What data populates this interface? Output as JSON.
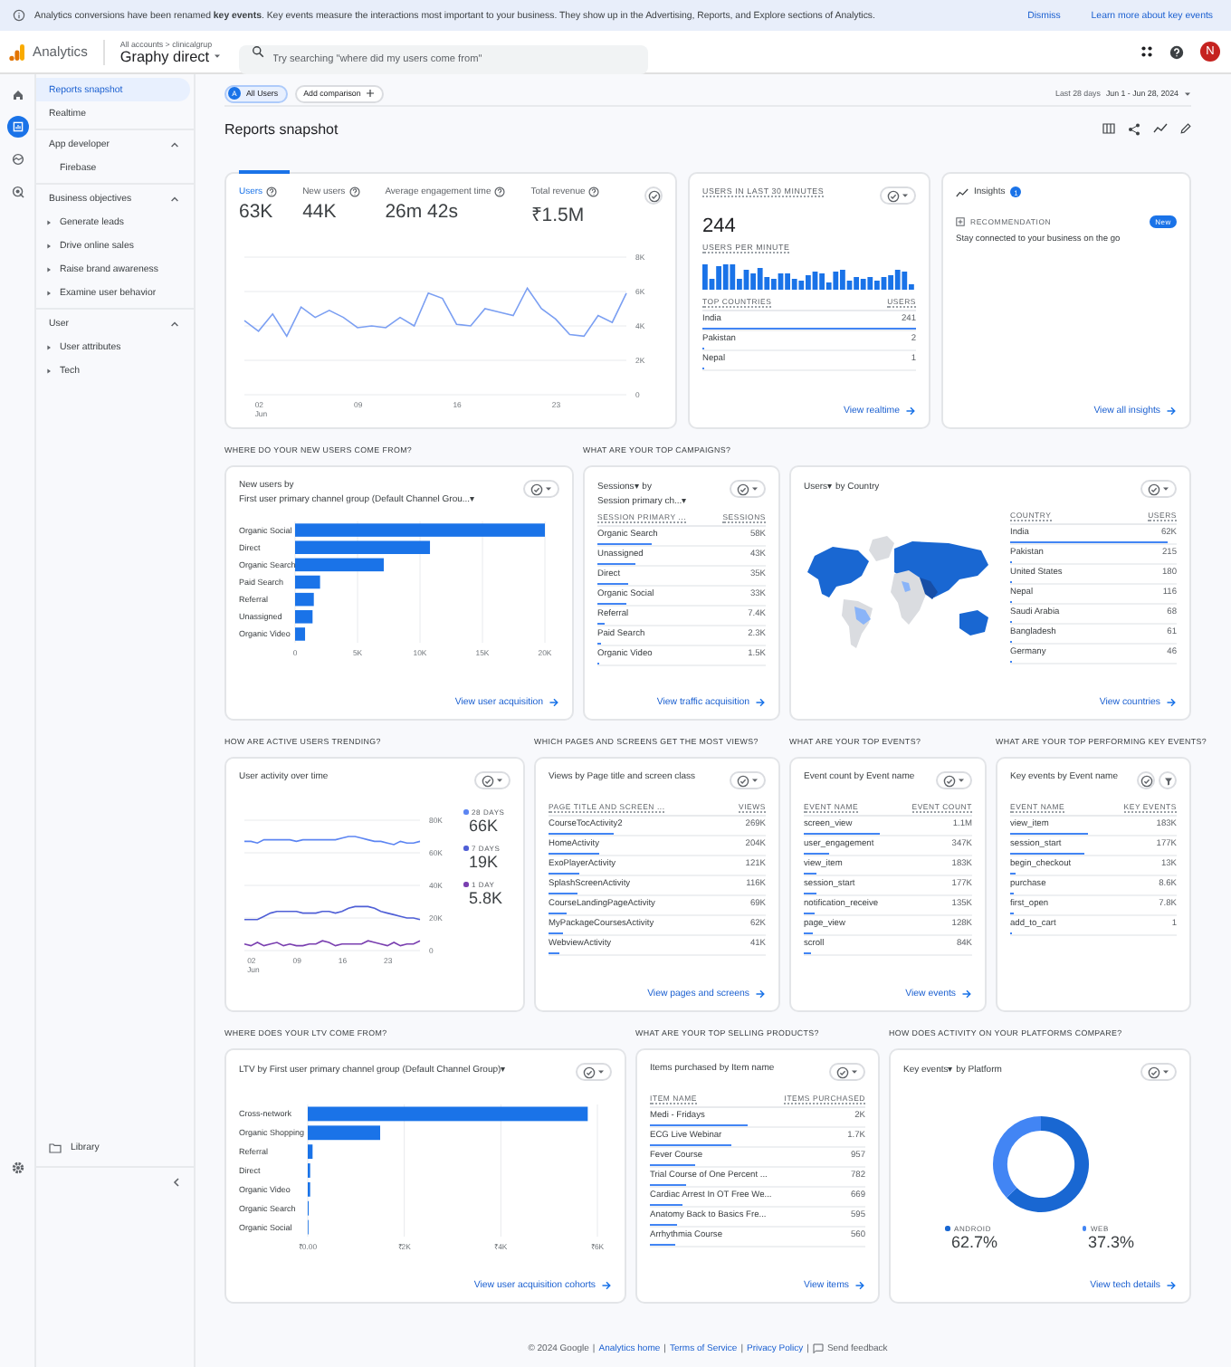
{
  "banner": {
    "text": "Analytics conversions have been renamed **key events**. Key events measure the interactions most important to your business. They show up in the Advertising, Reports, and Explore sections of Analytics.",
    "actions": [
      "Dismiss",
      "Learn more about key events"
    ]
  },
  "header": {
    "product": "Analytics",
    "breadcrumb": "All accounts > clinicalgrup",
    "property": "Graphy direct",
    "search": {
      "placeholder": "Try searching \"where did my users come from\""
    },
    "avatar": "N"
  },
  "rail": [
    {
      "kind": "home",
      "selected": false
    },
    {
      "kind": "reports",
      "selected": true
    },
    {
      "kind": "explore",
      "selected": false
    },
    {
      "kind": "advertising",
      "selected": false
    }
  ],
  "sidebar": {
    "items": [
      {
        "label": "Reports snapshot",
        "selected": true
      },
      {
        "label": "Realtime",
        "selected": false
      }
    ],
    "sections": [
      {
        "label": "App developer",
        "expanded": true,
        "children": [
          {
            "label": "Firebase",
            "expandable": false
          }
        ]
      },
      {
        "label": "Business objectives",
        "expanded": true,
        "children": [
          {
            "label": "Generate leads",
            "expandable": true
          },
          {
            "label": "Drive online sales",
            "expandable": true
          },
          {
            "label": "Raise brand awareness",
            "expandable": true
          },
          {
            "label": "Examine user behavior",
            "expandable": true
          }
        ]
      },
      {
        "label": "User",
        "expanded": true,
        "children": [
          {
            "label": "User attributes",
            "expandable": true
          },
          {
            "label": "Tech",
            "expandable": true
          }
        ]
      }
    ],
    "library": "Library"
  },
  "toolbar": {
    "segment_badge": "A",
    "segment": "All Users",
    "add_comparison": "Add comparison",
    "date_label": "Last 28 days",
    "date_range": "Jun 1 - Jun 28, 2024"
  },
  "page_title": "Reports snapshot",
  "overview": {
    "metrics": [
      {
        "label": "Users",
        "value": "63K",
        "selected": true
      },
      {
        "label": "New users",
        "value": "44K",
        "selected": false
      },
      {
        "label": "Average engagement time",
        "value": "26m 42s",
        "selected": false
      },
      {
        "label": "Total revenue",
        "value": "₹1.5M",
        "selected": false
      }
    ],
    "chart_data": {
      "type": "line",
      "x": [
        1,
        2,
        3,
        4,
        5,
        6,
        7,
        8,
        9,
        10,
        11,
        12,
        13,
        14,
        15,
        16,
        17,
        18,
        19,
        20,
        21,
        22,
        23,
        24,
        25,
        26,
        27,
        28
      ],
      "xlim": [
        1,
        28
      ],
      "ylim": [
        0,
        8000
      ],
      "grid": true,
      "series": [
        {
          "color": "#7b9ff2",
          "values": [
            4300,
            3700,
            4700,
            3400,
            5100,
            4500,
            4900,
            4500,
            3900,
            4000,
            3900,
            4500,
            4000,
            5900,
            5600,
            4100,
            4000,
            5000,
            4800,
            4600,
            6200,
            5000,
            4400,
            3500,
            3400,
            4600,
            4200,
            5900
          ]
        }
      ],
      "xticks": [
        {
          "value": 2,
          "label": "02 Jun"
        },
        {
          "value": 9,
          "label": "09"
        },
        {
          "value": 16,
          "label": "16"
        },
        {
          "value": 23,
          "label": "23"
        }
      ],
      "yticks": [
        {
          "value": 0,
          "label": "0"
        },
        {
          "value": 2000,
          "label": "2K"
        },
        {
          "value": 4000,
          "label": "4K"
        },
        {
          "value": 6000,
          "label": "6K"
        },
        {
          "value": 8000,
          "label": "8K"
        }
      ]
    }
  },
  "realtime": {
    "heading": "USERS IN LAST 30 MINUTES",
    "value": "244",
    "subheading": "USERS PER MINUTE",
    "columns": [
      "TOP COUNTRIES",
      "USERS"
    ],
    "rows": [
      {
        "name": "India",
        "value": "241",
        "level": 1
      },
      {
        "name": "Pakistan",
        "value": "2",
        "level": 0.01
      },
      {
        "name": "Nepal",
        "value": "1",
        "level": 0.01
      }
    ],
    "link": "View realtime"
  },
  "insights": {
    "title": "Insights",
    "count": "1",
    "tag": "RECOMMENDATION",
    "badge": "New",
    "text": "Stay connected to your business on the go",
    "link": "View all insights"
  },
  "acquisition": {
    "heading": "WHERE DO YOUR NEW USERS COME FROM?",
    "title_lines": [
      "New users by",
      "First user primary channel group (Default Channel Grou...▾"
    ],
    "chart_data": {
      "type": "bar",
      "orientation": "horizontal",
      "xlim": [
        0,
        20000
      ],
      "grid": true,
      "categories": [
        "Organic Social",
        "Direct",
        "Organic Search",
        "Paid Search",
        "Referral",
        "Unassigned",
        "Organic Video"
      ],
      "values": [
        20000,
        10800,
        7100,
        2000,
        1500,
        1400,
        800
      ],
      "xticks": [
        {
          "value": 0,
          "label": "0"
        },
        {
          "value": 5000,
          "label": "5K"
        },
        {
          "value": 10000,
          "label": "10K"
        },
        {
          "value": 15000,
          "label": "15K"
        },
        {
          "value": 20000,
          "label": "20K"
        }
      ]
    },
    "link": "View user acquisition"
  },
  "campaigns": {
    "heading": "WHAT ARE YOUR TOP CAMPAIGNS?",
    "title_lines": [
      "Sessions▾ by",
      "Session primary ch...▾"
    ],
    "columns": [
      "SESSION PRIMARY ...",
      "SESSIONS"
    ],
    "rows": [
      {
        "name": "Organic Search",
        "value": "58K",
        "level": 0.32
      },
      {
        "name": "Unassigned",
        "value": "43K",
        "level": 0.23
      },
      {
        "name": "Direct",
        "value": "35K",
        "level": 0.18
      },
      {
        "name": "Organic Social",
        "value": "33K",
        "level": 0.17
      },
      {
        "name": "Referral",
        "value": "7.4K",
        "level": 0.04
      },
      {
        "name": "Paid Search",
        "value": "2.3K",
        "level": 0.02
      },
      {
        "name": "Organic Video",
        "value": "1.5K",
        "level": 0.01
      }
    ],
    "link": "View traffic acquisition"
  },
  "countries": {
    "title_lines": [
      "Users▾ by Country"
    ],
    "columns": [
      "COUNTRY",
      "USERS"
    ],
    "rows": [
      {
        "name": "India",
        "value": "62K",
        "level": 0.95
      },
      {
        "name": "Pakistan",
        "value": "215",
        "level": 0.01
      },
      {
        "name": "United States",
        "value": "180",
        "level": 0.01
      },
      {
        "name": "Nepal",
        "value": "116",
        "level": 0.01
      },
      {
        "name": "Saudi Arabia",
        "value": "68",
        "level": 0.01
      },
      {
        "name": "Bangladesh",
        "value": "61",
        "level": 0.01
      },
      {
        "name": "Germany",
        "value": "46",
        "level": 0.01
      }
    ],
    "link": "View countries"
  },
  "active_users": {
    "heading": "HOW ARE ACTIVE USERS TRENDING?",
    "title_lines": [
      "User activity over time"
    ],
    "chart_data": {
      "type": "line",
      "x": [
        1,
        2,
        3,
        4,
        5,
        6,
        7,
        8,
        9,
        10,
        11,
        12,
        13,
        14,
        15,
        16,
        17,
        18,
        19,
        20,
        21,
        22,
        23,
        24,
        25,
        26,
        27,
        28
      ],
      "xlim": [
        1,
        28
      ],
      "ylim": [
        0,
        80000
      ],
      "grid": true,
      "series": [
        {
          "name": "28 DAYS",
          "color": "#5c85f2",
          "values": [
            67000,
            67000,
            66000,
            68000,
            68000,
            68000,
            68000,
            68000,
            67000,
            68000,
            68000,
            68000,
            68000,
            68000,
            68000,
            69000,
            70000,
            70000,
            69000,
            68000,
            67000,
            67000,
            66000,
            65000,
            67000,
            66000,
            66000,
            67000
          ]
        },
        {
          "name": "7 DAYS",
          "color": "#4f5fd6",
          "values": [
            19000,
            19000,
            19000,
            21000,
            23000,
            24000,
            24000,
            24000,
            24000,
            23000,
            23000,
            23000,
            24000,
            24000,
            23000,
            24000,
            26000,
            27000,
            27000,
            27000,
            26000,
            24000,
            23000,
            22000,
            21000,
            20000,
            20000,
            19000
          ]
        },
        {
          "name": "1 DAY",
          "color": "#7a3fb0",
          "values": [
            4000,
            3000,
            5000,
            3000,
            4000,
            5000,
            3000,
            4000,
            3000,
            3000,
            4000,
            4000,
            6000,
            5000,
            3000,
            4000,
            4000,
            4000,
            4000,
            6000,
            5000,
            4000,
            3000,
            5000,
            3000,
            4000,
            4000,
            6000
          ]
        }
      ],
      "xticks": [
        {
          "value": 2,
          "label": "02 Jun"
        },
        {
          "value": 9,
          "label": "09"
        },
        {
          "value": 16,
          "label": "16"
        },
        {
          "value": 23,
          "label": "23"
        }
      ],
      "yticks": [
        {
          "value": 0,
          "label": "0"
        },
        {
          "value": 20000,
          "label": "20K"
        },
        {
          "value": 40000,
          "label": "40K"
        },
        {
          "value": 60000,
          "label": "60K"
        },
        {
          "value": 80000,
          "label": "80K"
        }
      ]
    },
    "legend": [
      {
        "value": "66K"
      },
      {
        "value": "19K"
      },
      {
        "value": "5.8K"
      }
    ]
  },
  "pages": {
    "heading": "WHICH PAGES AND SCREENS GET THE MOST VIEWS?",
    "title_lines": [
      "Views by Page title and screen class"
    ],
    "columns": [
      "PAGE TITLE AND SCREEN ...",
      "VIEWS"
    ],
    "rows": [
      {
        "name": "CourseTocActivity2",
        "value": "269K",
        "level": 0.3
      },
      {
        "name": "HomeActivity",
        "value": "204K",
        "level": 0.23
      },
      {
        "name": "ExoPlayerActivity",
        "value": "121K",
        "level": 0.14
      },
      {
        "name": "SplashScreenActivity",
        "value": "116K",
        "level": 0.13
      },
      {
        "name": "CourseLandingPageActivity",
        "value": "69K",
        "level": 0.08
      },
      {
        "name": "MyPackageCoursesActivity",
        "value": "62K",
        "level": 0.07
      },
      {
        "name": "WebviewActivity",
        "value": "41K",
        "level": 0.05
      }
    ],
    "link": "View pages and screens"
  },
  "events": {
    "heading": "WHAT ARE YOUR TOP EVENTS?",
    "title_lines": [
      "Event count by Event name"
    ],
    "columns": [
      "EVENT NAME",
      "EVENT COUNT"
    ],
    "rows": [
      {
        "name": "screen_view",
        "value": "1.1M",
        "level": 0.45
      },
      {
        "name": "user_engagement",
        "value": "347K",
        "level": 0.15
      },
      {
        "name": "view_item",
        "value": "183K",
        "level": 0.08
      },
      {
        "name": "session_start",
        "value": "177K",
        "level": 0.08
      },
      {
        "name": "notification_receive",
        "value": "135K",
        "level": 0.06
      },
      {
        "name": "page_view",
        "value": "128K",
        "level": 0.05
      },
      {
        "name": "scroll",
        "value": "84K",
        "level": 0.04
      }
    ],
    "link": "View events"
  },
  "key_events": {
    "heading": "WHAT ARE YOUR TOP PERFORMING KEY EVENTS?",
    "title_lines": [
      "Key events by Event name"
    ],
    "columns": [
      "EVENT NAME",
      "KEY EVENTS"
    ],
    "rows": [
      {
        "name": "view_item",
        "value": "183K",
        "level": 0.47
      },
      {
        "name": "session_start",
        "value": "177K",
        "level": 0.45
      },
      {
        "name": "begin_checkout",
        "value": "13K",
        "level": 0.03
      },
      {
        "name": "purchase",
        "value": "8.6K",
        "level": 0.02
      },
      {
        "name": "first_open",
        "value": "7.8K",
        "level": 0.02
      },
      {
        "name": "add_to_cart",
        "value": "1",
        "level": 0.01
      }
    ]
  },
  "ltv": {
    "heading": "WHERE DOES YOUR LTV COME FROM?",
    "title_lines": [
      "LTV by First user primary channel group (Default Channel Group)▾"
    ],
    "chart_data": {
      "type": "bar",
      "orientation": "horizontal",
      "xlim": [
        0,
        6000
      ],
      "grid": true,
      "categories": [
        "Cross-network",
        "Organic Shopping",
        "Referral",
        "Direct",
        "Organic Video",
        "Organic Search",
        "Organic Social"
      ],
      "values": [
        5800,
        1500,
        100,
        50,
        50,
        20,
        10
      ],
      "xticks": [
        {
          "value": 0,
          "label": "₹0.00"
        },
        {
          "value": 2000,
          "label": "₹2K"
        },
        {
          "value": 4000,
          "label": "₹4K"
        },
        {
          "value": 6000,
          "label": "₹6K"
        }
      ]
    },
    "link": "View user acquisition cohorts"
  },
  "products": {
    "heading": "WHAT ARE YOUR TOP SELLING PRODUCTS?",
    "title_lines": [
      "Items purchased by Item name"
    ],
    "columns": [
      "ITEM NAME",
      "ITEMS PURCHASED"
    ],
    "rows": [
      {
        "name": "Medi - Fridays",
        "value": "2K",
        "level": 0.45
      },
      {
        "name": "ECG Live Webinar",
        "value": "1.7K",
        "level": 0.38
      },
      {
        "name": "Fever Course",
        "value": "957",
        "level": 0.21
      },
      {
        "name": "Trial Course of One Percent ...",
        "value": "782",
        "level": 0.17
      },
      {
        "name": "Cardiac Arrest In OT Free We...",
        "value": "669",
        "level": 0.15
      },
      {
        "name": "Anatomy Back to Basics Fre...",
        "value": "595",
        "level": 0.13
      },
      {
        "name": "Arrhythmia Course",
        "value": "560",
        "level": 0.12
      }
    ],
    "link": "View items"
  },
  "platforms": {
    "heading": "HOW DOES ACTIVITY ON YOUR PLATFORMS COMPARE?",
    "title_lines": [
      "Key events▾ by Platform"
    ],
    "chart_data": {
      "type": "donut",
      "categories": [
        "ANDROID",
        "WEB"
      ],
      "values": [
        62.7,
        37.3
      ]
    },
    "legend": [
      {
        "value": "62.7%",
        "color": "#1967d2"
      },
      {
        "value": "37.3%",
        "color": "#4285f4"
      }
    ],
    "link": "View tech details"
  },
  "footer": {
    "copyright": "© 2024 Google",
    "links": [
      {
        "separator": "|",
        "label": "Analytics home"
      },
      {
        "separator": "|",
        "label": "Terms of Service"
      },
      {
        "separator": "|",
        "label": "Privacy Policy"
      }
    ],
    "feedback": {
      "separator": "|",
      "label": "Send feedback"
    }
  }
}
